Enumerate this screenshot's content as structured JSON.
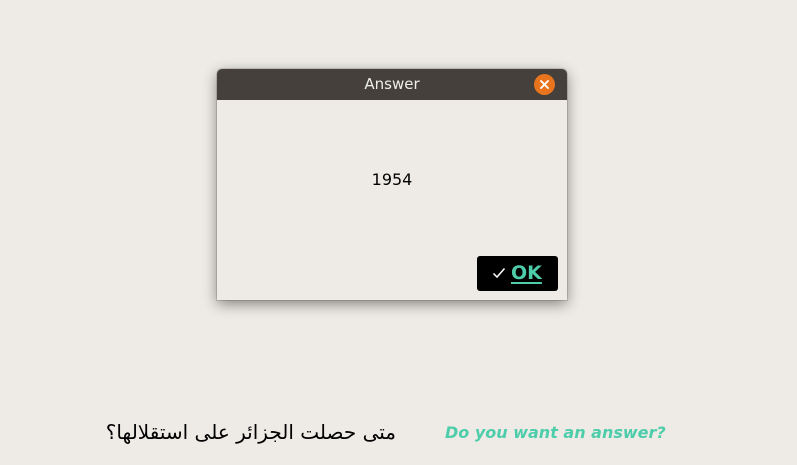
{
  "dialog": {
    "title": "Answer",
    "answer": "1954",
    "ok_label": "OK",
    "close_icon": "close-icon",
    "check_icon": "check-icon"
  },
  "main": {
    "question": "متى حصلت الجزائر على استقلالها؟",
    "prompt_link": "Do you want an answer?"
  },
  "colors": {
    "background": "#eeebe6",
    "titlebar": "#45403c",
    "close_button": "#e9741e",
    "accent": "#4ecdab",
    "ok_button": "#000000"
  }
}
